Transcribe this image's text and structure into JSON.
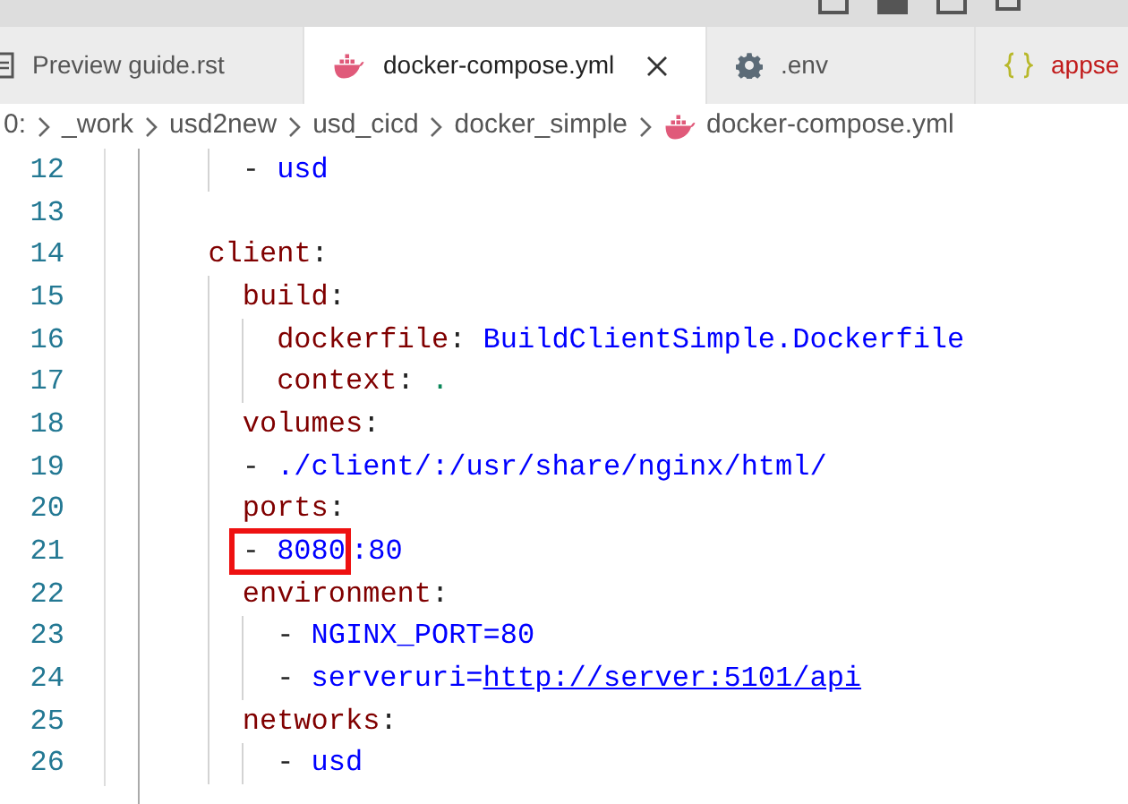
{
  "tabs": [
    {
      "label": "Preview guide.rst",
      "selected": false,
      "error": false
    },
    {
      "label": "docker-compose.yml",
      "selected": true,
      "error": false
    },
    {
      "label": ".env",
      "selected": false,
      "error": false
    },
    {
      "label": "appse",
      "selected": false,
      "error": true
    }
  ],
  "breadcrumbs": [
    {
      "label": "0:"
    },
    {
      "label": "_work"
    },
    {
      "label": "usd2new"
    },
    {
      "label": "usd_cicd"
    },
    {
      "label": "docker_simple"
    },
    {
      "label": "docker-compose.yml"
    }
  ],
  "lines": [
    {
      "number": "12",
      "tokens": [
        {
          "kind": "punct",
          "text": "- "
        },
        {
          "kind": "value",
          "text": "usd"
        }
      ]
    },
    {
      "number": "13"
    },
    {
      "number": "14",
      "tokens": [
        {
          "kind": "key",
          "text": "client"
        },
        {
          "kind": "punct",
          "text": ":"
        }
      ]
    },
    {
      "number": "15",
      "tokens": [
        {
          "kind": "key",
          "text": "build"
        },
        {
          "kind": "punct",
          "text": ":"
        }
      ]
    },
    {
      "number": "16",
      "tokens": [
        {
          "kind": "key",
          "text": "dockerfile"
        },
        {
          "kind": "punct",
          "text": ": "
        },
        {
          "kind": "value",
          "text": "BuildClientSimple.Dockerfile"
        }
      ]
    },
    {
      "number": "17",
      "tokens": [
        {
          "kind": "key",
          "text": "context"
        },
        {
          "kind": "punct",
          "text": ": "
        },
        {
          "kind": "number",
          "text": "."
        }
      ]
    },
    {
      "number": "18",
      "tokens": [
        {
          "kind": "key",
          "text": "volumes"
        },
        {
          "kind": "punct",
          "text": ":"
        }
      ]
    },
    {
      "number": "19",
      "tokens": [
        {
          "kind": "punct",
          "text": "- "
        },
        {
          "kind": "value",
          "text": "./client/:/usr/share/nginx/html/"
        }
      ]
    },
    {
      "number": "20",
      "tokens": [
        {
          "kind": "key",
          "text": "ports"
        },
        {
          "kind": "punct",
          "text": ":"
        }
      ]
    },
    {
      "number": "21",
      "tokens": [
        {
          "kind": "highlight",
          "children": [
            {
              "kind": "punct",
              "text": "- "
            },
            {
              "kind": "value",
              "text": "8080"
            }
          ]
        },
        {
          "kind": "value",
          "text": ":80"
        }
      ]
    },
    {
      "number": "22",
      "tokens": [
        {
          "kind": "key",
          "text": "environment"
        },
        {
          "kind": "punct",
          "text": ":"
        }
      ]
    },
    {
      "number": "23",
      "tokens": [
        {
          "kind": "punct",
          "text": "- "
        },
        {
          "kind": "value",
          "text": "NGINX_PORT=80"
        }
      ]
    },
    {
      "number": "24",
      "tokens": [
        {
          "kind": "punct",
          "text": "- "
        },
        {
          "kind": "value",
          "text": "serveruri="
        },
        {
          "kind": "link",
          "text": "http://server:5101/api"
        }
      ]
    },
    {
      "number": "25",
      "tokens": [
        {
          "kind": "key",
          "text": "networks"
        },
        {
          "kind": "punct",
          "text": ":"
        }
      ]
    },
    {
      "number": "26",
      "tokens": [
        {
          "kind": "punct",
          "text": "- "
        },
        {
          "kind": "value",
          "text": "usd"
        }
      ]
    }
  ]
}
